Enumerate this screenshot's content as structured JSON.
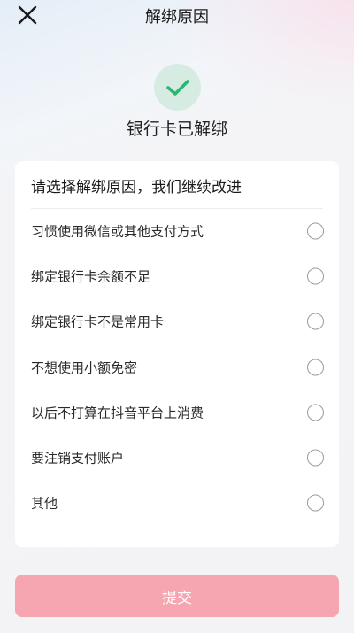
{
  "header": {
    "title": "解绑原因",
    "close_icon": "close-icon"
  },
  "status": {
    "icon": "check-icon",
    "icon_color": "#2bb673",
    "title": "银行卡已解绑"
  },
  "reasons": {
    "heading": "请选择解绑原因，我们继续改进",
    "items": [
      {
        "label": "习惯使用微信或其他支付方式",
        "selected": false
      },
      {
        "label": "绑定银行卡余额不足",
        "selected": false
      },
      {
        "label": "绑定银行卡不是常用卡",
        "selected": false
      },
      {
        "label": "不想使用小额免密",
        "selected": false
      },
      {
        "label": "以后不打算在抖音平台上消费",
        "selected": false
      },
      {
        "label": "要注销支付账户",
        "selected": false
      },
      {
        "label": "其他",
        "selected": false
      }
    ]
  },
  "footer": {
    "submit_label": "提交",
    "submit_color": "#f6a6b1"
  }
}
